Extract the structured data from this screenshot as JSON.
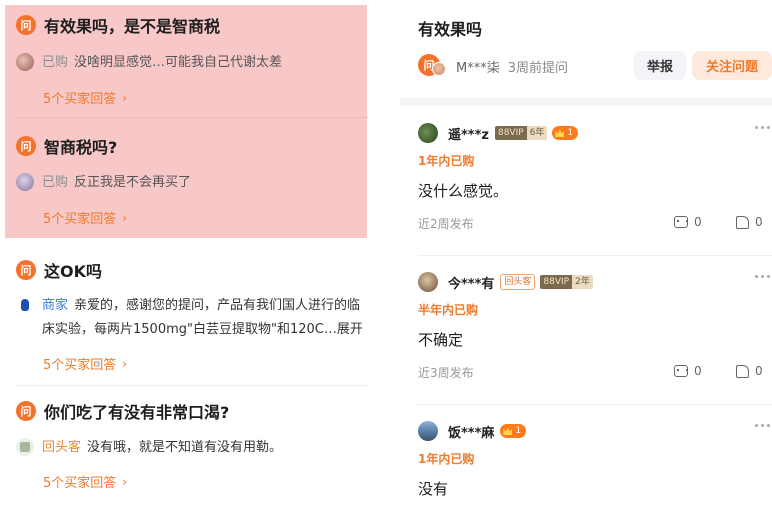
{
  "left": {
    "questions": [
      {
        "icon": "问",
        "title": "有效果吗，是不是智商税",
        "answer_tag": "已购",
        "answer_text": "没啥明显感觉…可能我自己代谢太差",
        "more": "5个买家回答",
        "highlighted": true
      },
      {
        "icon": "问",
        "title": "智商税吗?",
        "answer_tag": "已购",
        "answer_text": "反正我是不会再买了",
        "more": "5个买家回答",
        "highlighted": true
      },
      {
        "icon": "问",
        "title": "这OK吗",
        "answer_tag": "商家",
        "answer_text_line1": "亲爱的，感谢您的提问，产品有我们国人进行的临",
        "answer_text_line2": "床实验，每两片1500mg\"白芸豆提取物\"和120C…展开",
        "more": "5个买家回答",
        "highlighted": false
      },
      {
        "icon": "问",
        "title": "你们吃了有没有非常口渴?",
        "answer_tag": "回头客",
        "answer_text": "没有哦，就是不知道有没有用勒。",
        "more": "5个买家回答",
        "highlighted": false
      }
    ],
    "colors": {
      "highlight": "#f8c7c7",
      "accent": "#f07a2b",
      "merchant": "#3b7bd9"
    }
  },
  "right": {
    "title": "有效果吗",
    "asker": {
      "icon": "问",
      "name": "M***柒",
      "time": "3周前提问"
    },
    "report_label": "举报",
    "follow_label": "关注问题",
    "answers": [
      {
        "name": "遥***z",
        "vip_left": "88VIP",
        "vip_right": "6年",
        "level": "1",
        "period": "1年内已购",
        "text": "没什么感觉。",
        "time": "近2周发布",
        "comments": "0",
        "likes": "0"
      },
      {
        "name": "今***有",
        "tag": "回头客",
        "vip_left": "88VIP",
        "vip_right": "2年",
        "period": "半年内已购",
        "text": "不确定",
        "time": "近3周发布",
        "comments": "0",
        "likes": "0"
      },
      {
        "name": "饭***麻",
        "level": "1",
        "period": "1年内已购",
        "text": "没有"
      }
    ]
  }
}
